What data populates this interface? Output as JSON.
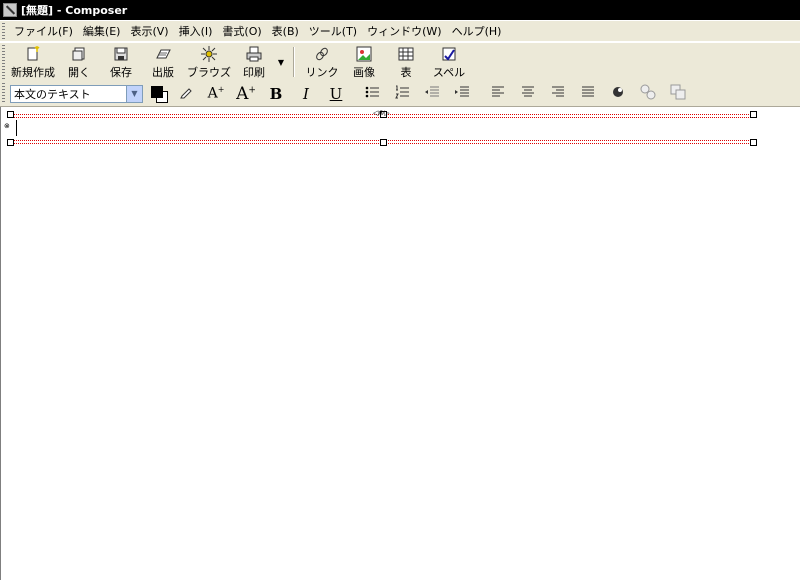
{
  "window": {
    "title": "[無題] - Composer",
    "app_icon": "composer-app-icon"
  },
  "menu": [
    {
      "label": "ファイル(F)"
    },
    {
      "label": "編集(E)"
    },
    {
      "label": "表示(V)"
    },
    {
      "label": "挿入(I)"
    },
    {
      "label": "書式(O)"
    },
    {
      "label": "表(B)"
    },
    {
      "label": "ツール(T)"
    },
    {
      "label": "ウィンドウ(W)"
    },
    {
      "label": "ヘルプ(H)"
    }
  ],
  "toolbar": {
    "new": "新規作成",
    "open": "開く",
    "save": "保存",
    "publish": "出版",
    "browse": "ブラウズ",
    "print": "印刷",
    "link": "リンク",
    "image": "画像",
    "table": "表",
    "spell": "スペル"
  },
  "format": {
    "paragraph_style": "本文のテキスト",
    "text_color": "#000000",
    "background_color": "#ffffff",
    "bold": "B",
    "italic": "I",
    "underline": "U"
  }
}
